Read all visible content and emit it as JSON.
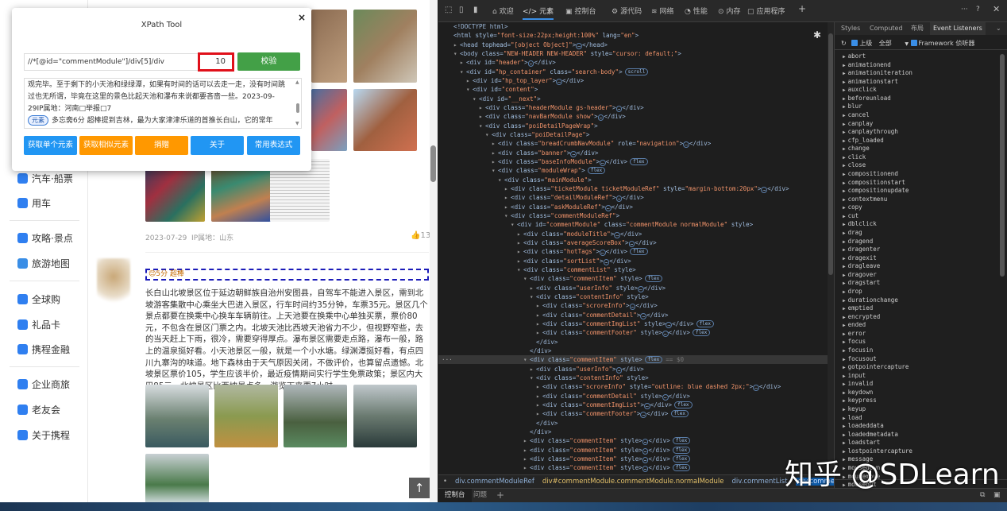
{
  "sidebar": {
    "items": [
      {
        "label": "汽车·船票",
        "icon": "bus-icon",
        "color": "#2f7ff0"
      },
      {
        "label": "用车",
        "icon": "car-icon",
        "color": "#2f7ff0"
      },
      {
        "label": "攻略·景点",
        "icon": "book-icon",
        "color": "#2f7ff0"
      },
      {
        "label": "旅游地图",
        "icon": "map-icon",
        "color": "#3a8ee6"
      },
      {
        "label": "全球购",
        "icon": "globe-shop-icon",
        "color": "#2f7ff0"
      },
      {
        "label": "礼品卡",
        "icon": "gift-card-icon",
        "color": "#2f7ff0"
      },
      {
        "label": "携程金融",
        "icon": "finance-icon",
        "color": "#2f7ff0"
      },
      {
        "label": "企业商旅",
        "icon": "business-travel-icon",
        "color": "#2f7ff0"
      },
      {
        "label": "老友会",
        "icon": "club-icon",
        "color": "#2f7ff0"
      },
      {
        "label": "关于携程",
        "icon": "about-icon",
        "color": "#2f7ff0"
      }
    ]
  },
  "page": {
    "prev_comment": {
      "date": "2023-07-29",
      "ip": "IP属地：山东",
      "likes": "13"
    },
    "comment": {
      "score": "5分 超棒",
      "text": "长白山北坡景区位于延边朝鲜族自治州安图县，自驾车不能进入景区，需到北坡游客集散中心乘坐大巴进入景区，行车时间约35分钟，车票35元。景区几个景点都要在换乘中心换车车辆前往。上天池要在换乘中心单独买票，票价80元，不包含在景区门票之内。北坡天池比西坡天池省力不少，但视野窄些，去的当天赶上下雨，很冷，需要穿得厚点。瀑布景区需要走点路，瀑布一般，路上的温泉挺好看。小天池景区一般，就是一个小水塘。绿渊潭挺好看，有点四川九寨沟的味道。地下森林由于天气原因关闭，不做评价，也算留点遗憾。北坡景区票价105，学生应该半价，最近疫情期间实行学生免票政策；景区内大巴85元。北坡景区比西坡景点多，游览下来要7小时。"
    },
    "to_top": "↑"
  },
  "xpath_tool": {
    "title": "XPath Tool",
    "close": "×",
    "xpath": "//*[@id=\"commentModule\"]/div[5]/div",
    "count": "10",
    "verify": "校验",
    "result_text": "观完毕。至于剩下的小天池和绿绿潭，如果有时间的话可以去走一走，没有时间跳过也无所谓，毕竟在这里的景色比起天池和瀑布来说都要吝啬一些。2023-09-29IP属地：河南□举报□7",
    "result_tag": "元素",
    "result_text2": "多忘斋6分 超棒提到吉林，最为大家津津乐道的首推长白山，它的常年",
    "buttons": [
      {
        "label": "获取单个元素",
        "color": "#2196f3"
      },
      {
        "label": "获取相似元素",
        "color": "#ff9800"
      },
      {
        "label": "捐赠",
        "color": "#ff9800"
      },
      {
        "label": "关于",
        "color": "#2196f3"
      },
      {
        "label": "常用表达式",
        "color": "#2196f3"
      }
    ]
  },
  "devtools": {
    "tabs": [
      "欢迎",
      "元素",
      "控制台",
      "源代码",
      "网络",
      "性能",
      "内存",
      "应用程序"
    ],
    "active_tab": "元素",
    "tree": [
      {
        "d": 0,
        "a": "",
        "t": "<!DOCTYPE html>"
      },
      {
        "d": 0,
        "a": "",
        "t": "<html style=\"font-size:22px;height:100%\" lang=\"en\">"
      },
      {
        "d": 1,
        "a": "▸",
        "t": "<head tophead=\"[object Object]\">…</head>"
      },
      {
        "d": 1,
        "a": "▾",
        "t": "<body class=\"NEW-HEADER NEW-HEADER\" style=\"cursor: default;\">"
      },
      {
        "d": 2,
        "a": "▸",
        "t": "<div id=\"header\">…</div>"
      },
      {
        "d": 2,
        "a": "▾",
        "t": "<div id=\"hp_container\" class=\"search-body\">",
        "b": "scroll"
      },
      {
        "d": 3,
        "a": "▸",
        "t": "<div id=\"hp_top_layer\">…</div>"
      },
      {
        "d": 3,
        "a": "▾",
        "t": "<div id=\"content\">"
      },
      {
        "d": 4,
        "a": "▾",
        "t": "<div id=\"__next\">"
      },
      {
        "d": 5,
        "a": "▸",
        "t": "<div class=\"headerModule gs-header\">…</div>"
      },
      {
        "d": 5,
        "a": "▸",
        "t": "<div class=\"navBarModule show\">…</div>"
      },
      {
        "d": 5,
        "a": "▾",
        "t": "<div class=\"poiDetailPageWrap\">"
      },
      {
        "d": 6,
        "a": "▾",
        "t": "<div class=\"poiDetailPage\">"
      },
      {
        "d": 7,
        "a": "▸",
        "t": "<div class=\"breadCrumbNavModule\" role=\"navigation\">…</div>"
      },
      {
        "d": 7,
        "a": "▸",
        "t": "<div class=\"banner\">…</div>"
      },
      {
        "d": 7,
        "a": "▸",
        "t": "<div class=\"baseInfoModule\">…</div>",
        "b": "flex"
      },
      {
        "d": 7,
        "a": "▾",
        "t": "<div class=\"moduleWrap\">",
        "b": "flex"
      },
      {
        "d": 8,
        "a": "▾",
        "t": "<div class=\"mainModule\">"
      },
      {
        "d": 9,
        "a": "▸",
        "t": "<div class=\"ticketModule ticketModuleRef\" style=\"margin-bottom:20px\">…</div>"
      },
      {
        "d": 9,
        "a": "▸",
        "t": "<div class=\"detailModuleRef\">…</div>"
      },
      {
        "d": 9,
        "a": "▸",
        "t": "<div class=\"askModuleRef\">…</div>"
      },
      {
        "d": 9,
        "a": "▾",
        "t": "<div class=\"commentModuleRef\">"
      },
      {
        "d": 10,
        "a": "▾",
        "t": "<div id=\"commentModule\" class=\"commentModule normalModule\" style>"
      },
      {
        "d": 11,
        "a": "▸",
        "t": "<div class=\"moduleTitle\">…</div>"
      },
      {
        "d": 11,
        "a": "▸",
        "t": "<div class=\"averageScoreBox\">…</div>"
      },
      {
        "d": 11,
        "a": "▸",
        "t": "<div class=\"hotTags\">…</div>",
        "b": "flex"
      },
      {
        "d": 11,
        "a": "▸",
        "t": "<div class=\"sortList\">…</div>"
      },
      {
        "d": 11,
        "a": "▾",
        "t": "<div class=\"commentList\" style>"
      },
      {
        "d": 12,
        "a": "▾",
        "t": "<div class=\"commentItem\" style>",
        "b": "flex"
      },
      {
        "d": 13,
        "a": "▸",
        "t": "<div class=\"userInfo\" style>…</div>"
      },
      {
        "d": 13,
        "a": "▾",
        "t": "<div class=\"contentInfo\" style>"
      },
      {
        "d": 14,
        "a": "▸",
        "t": "<div class=\"scroreInfo\">…</div>"
      },
      {
        "d": 14,
        "a": "▸",
        "t": "<div class=\"commentDetail\">…</div>"
      },
      {
        "d": 14,
        "a": "▸",
        "t": "<div class=\"commentImgList\" style>…</div>",
        "b": "flex"
      },
      {
        "d": 14,
        "a": "▸",
        "t": "<div class=\"commentFooter\" style>…</div>",
        "b": "flex"
      },
      {
        "d": 13,
        "a": "",
        "t": "</div>"
      },
      {
        "d": 12,
        "a": "",
        "t": "</div>"
      },
      {
        "d": 12,
        "a": "▾",
        "t": "<div class=\"commentItem\" style>",
        "b": "flex",
        "s": "== $0",
        "sel": true
      },
      {
        "d": 13,
        "a": "▸",
        "t": "<div class=\"userInfo\">…</div>"
      },
      {
        "d": 13,
        "a": "▾",
        "t": "<div class=\"contentInfo\" style>"
      },
      {
        "d": 14,
        "a": "▸",
        "t": "<div class=\"scroreInfo\" style=\"outline: blue dashed 2px;\">…</div>"
      },
      {
        "d": 14,
        "a": "▸",
        "t": "<div class=\"commentDetail\" style>…</div>"
      },
      {
        "d": 14,
        "a": "▸",
        "t": "<div class=\"commentImgList\">…</div>",
        "b": "flex"
      },
      {
        "d": 14,
        "a": "▸",
        "t": "<div class=\"commentFooter\">…</div>",
        "b": "flex"
      },
      {
        "d": 13,
        "a": "",
        "t": "</div>"
      },
      {
        "d": 12,
        "a": "",
        "t": "</div>"
      },
      {
        "d": 12,
        "a": "▸",
        "t": "<div class=\"commentItem\" style>…</div>",
        "b": "flex"
      },
      {
        "d": 12,
        "a": "▸",
        "t": "<div class=\"commentItem\" style>…</div>",
        "b": "flex"
      },
      {
        "d": 12,
        "a": "▸",
        "t": "<div class=\"commentItem\" style>…</div>",
        "b": "flex"
      },
      {
        "d": 12,
        "a": "▸",
        "t": "<div class=\"commentItem\" style>…</div>",
        "b": "flex"
      }
    ],
    "breadcrumbs": [
      "div.commentModuleRef",
      "div#commentModule.commentModule.normalModule",
      "div.commentList",
      "div.commentItem"
    ],
    "bottom_tabs": [
      "控制台",
      "问题"
    ],
    "right_tabs": [
      "Styles",
      "Computed",
      "布局",
      "Event Listeners"
    ],
    "right_filter": {
      "ancestors": "上级",
      "all": "全部",
      "framework": "Framework 侦听器"
    },
    "events": [
      "abort",
      "animationend",
      "animationiteration",
      "animationstart",
      "auxclick",
      "beforeunload",
      "blur",
      "cancel",
      "canplay",
      "canplaythrough",
      "cfp_loaded",
      "change",
      "click",
      "close",
      "compositionend",
      "compositionstart",
      "compositionupdate",
      "contextmenu",
      "copy",
      "cut",
      "dblclick",
      "drag",
      "dragend",
      "dragenter",
      "dragexit",
      "dragleave",
      "dragover",
      "dragstart",
      "drop",
      "durationchange",
      "emptied",
      "encrypted",
      "ended",
      "error",
      "focus",
      "focusin",
      "focusout",
      "gotpointercapture",
      "input",
      "invalid",
      "keydown",
      "keypress",
      "keyup",
      "load",
      "loadeddata",
      "loadedmetadata",
      "loadstart",
      "lostpointercapture",
      "message",
      "mousedown",
      "mousemove",
      "mouseout"
    ]
  },
  "watermark": "知乎 @SDLearn"
}
